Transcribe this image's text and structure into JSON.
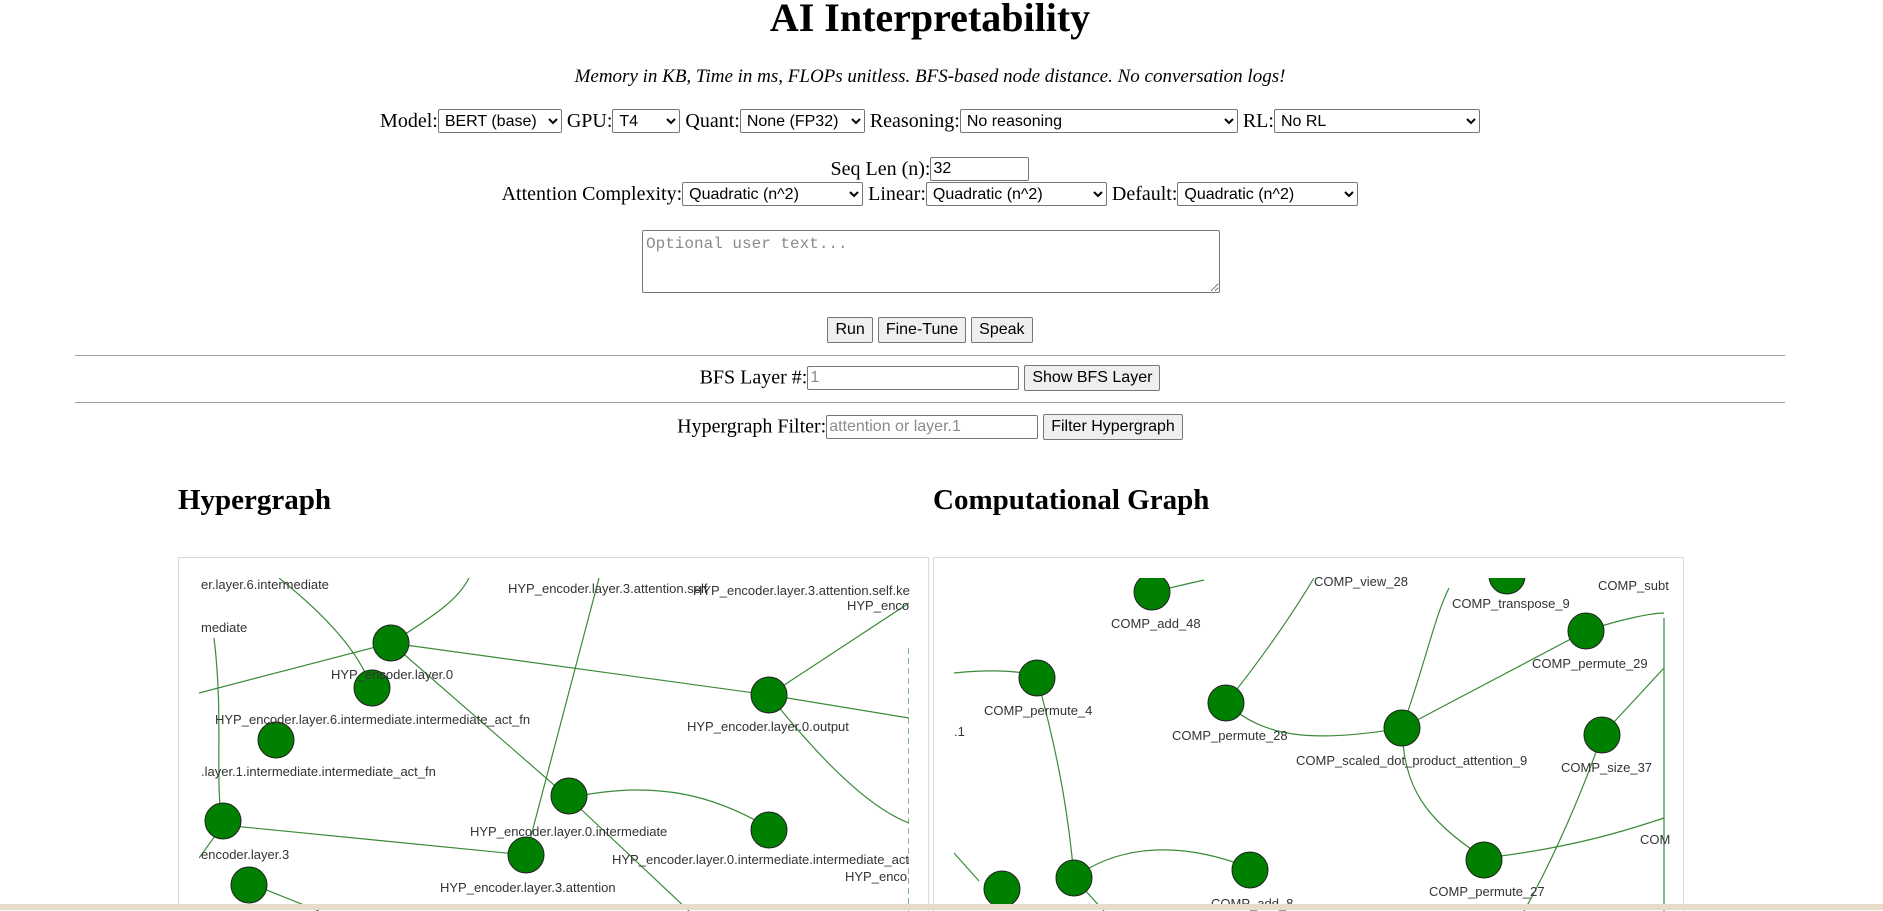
{
  "title": "AI Interpretability",
  "subtitle": "Memory in KB, Time in ms, FLOPs unitless. BFS-based node distance. No conversation logs!",
  "controls": {
    "model_label": "Model:",
    "model_value": "BERT (base)",
    "gpu_label": "GPU:",
    "gpu_value": "T4",
    "quant_label": "Quant:",
    "quant_value": "None (FP32)",
    "reasoning_label": "Reasoning:",
    "reasoning_value": "No reasoning",
    "rl_label": "RL:",
    "rl_value": "No RL",
    "seqlen_label": "Seq Len (n):",
    "seqlen_value": "32",
    "attention_label": "Attention Complexity:",
    "attention_value": "Quadratic (n^2)",
    "linear_label": "Linear:",
    "linear_value": "Quadratic (n^2)",
    "default_label": "Default:",
    "default_value": "Quadratic (n^2)",
    "user_text_placeholder": "Optional user text...",
    "run_label": "Run",
    "finetune_label": "Fine-Tune",
    "speak_label": "Speak"
  },
  "bfs": {
    "label": "BFS Layer #:",
    "placeholder": "1",
    "button": "Show BFS Layer"
  },
  "filter": {
    "label": "Hypergraph Filter:",
    "placeholder": "attention or layer.1",
    "button": "Filter Hypergraph"
  },
  "colors": {
    "node": "#008000",
    "edge": "#3a8a3a"
  },
  "hypergraph": {
    "heading": "Hypergraph",
    "labels": [
      "er.layer.6.intermediate",
      "mediate",
      "HYP_encoder.layer.3.attention.self",
      "HYP_encoder.layer.3.attention.self.ke",
      "HYP_enco",
      "HYP_encoder.layer.0",
      "HYP_encoder.layer.6.intermediate.intermediate_act_fn",
      "HYP_encoder.layer.0.output",
      ".layer.1.intermediate.intermediate_act_fn",
      "HYP_encoder.layer.0.intermediate",
      "encoder.layer.3",
      "HYP_encoder.layer.0.intermediate.intermediate_act",
      "HYP_encoder.layer.3.attention",
      "HYP_enco"
    ]
  },
  "compgraph": {
    "heading": "Computational Graph",
    "labels": [
      "COMP_add_48",
      "COMP_view_28",
      "COMP_transpose_9",
      "COMP_subt",
      "COMP_permute_29",
      "COMP_permute_4",
      "COMP_permute_28",
      "COMP_scaled_dot_product_attention_9",
      "COMP_size_37",
      ".1",
      "COMP_permute_27",
      "COM",
      "COMP_add_8"
    ]
  }
}
